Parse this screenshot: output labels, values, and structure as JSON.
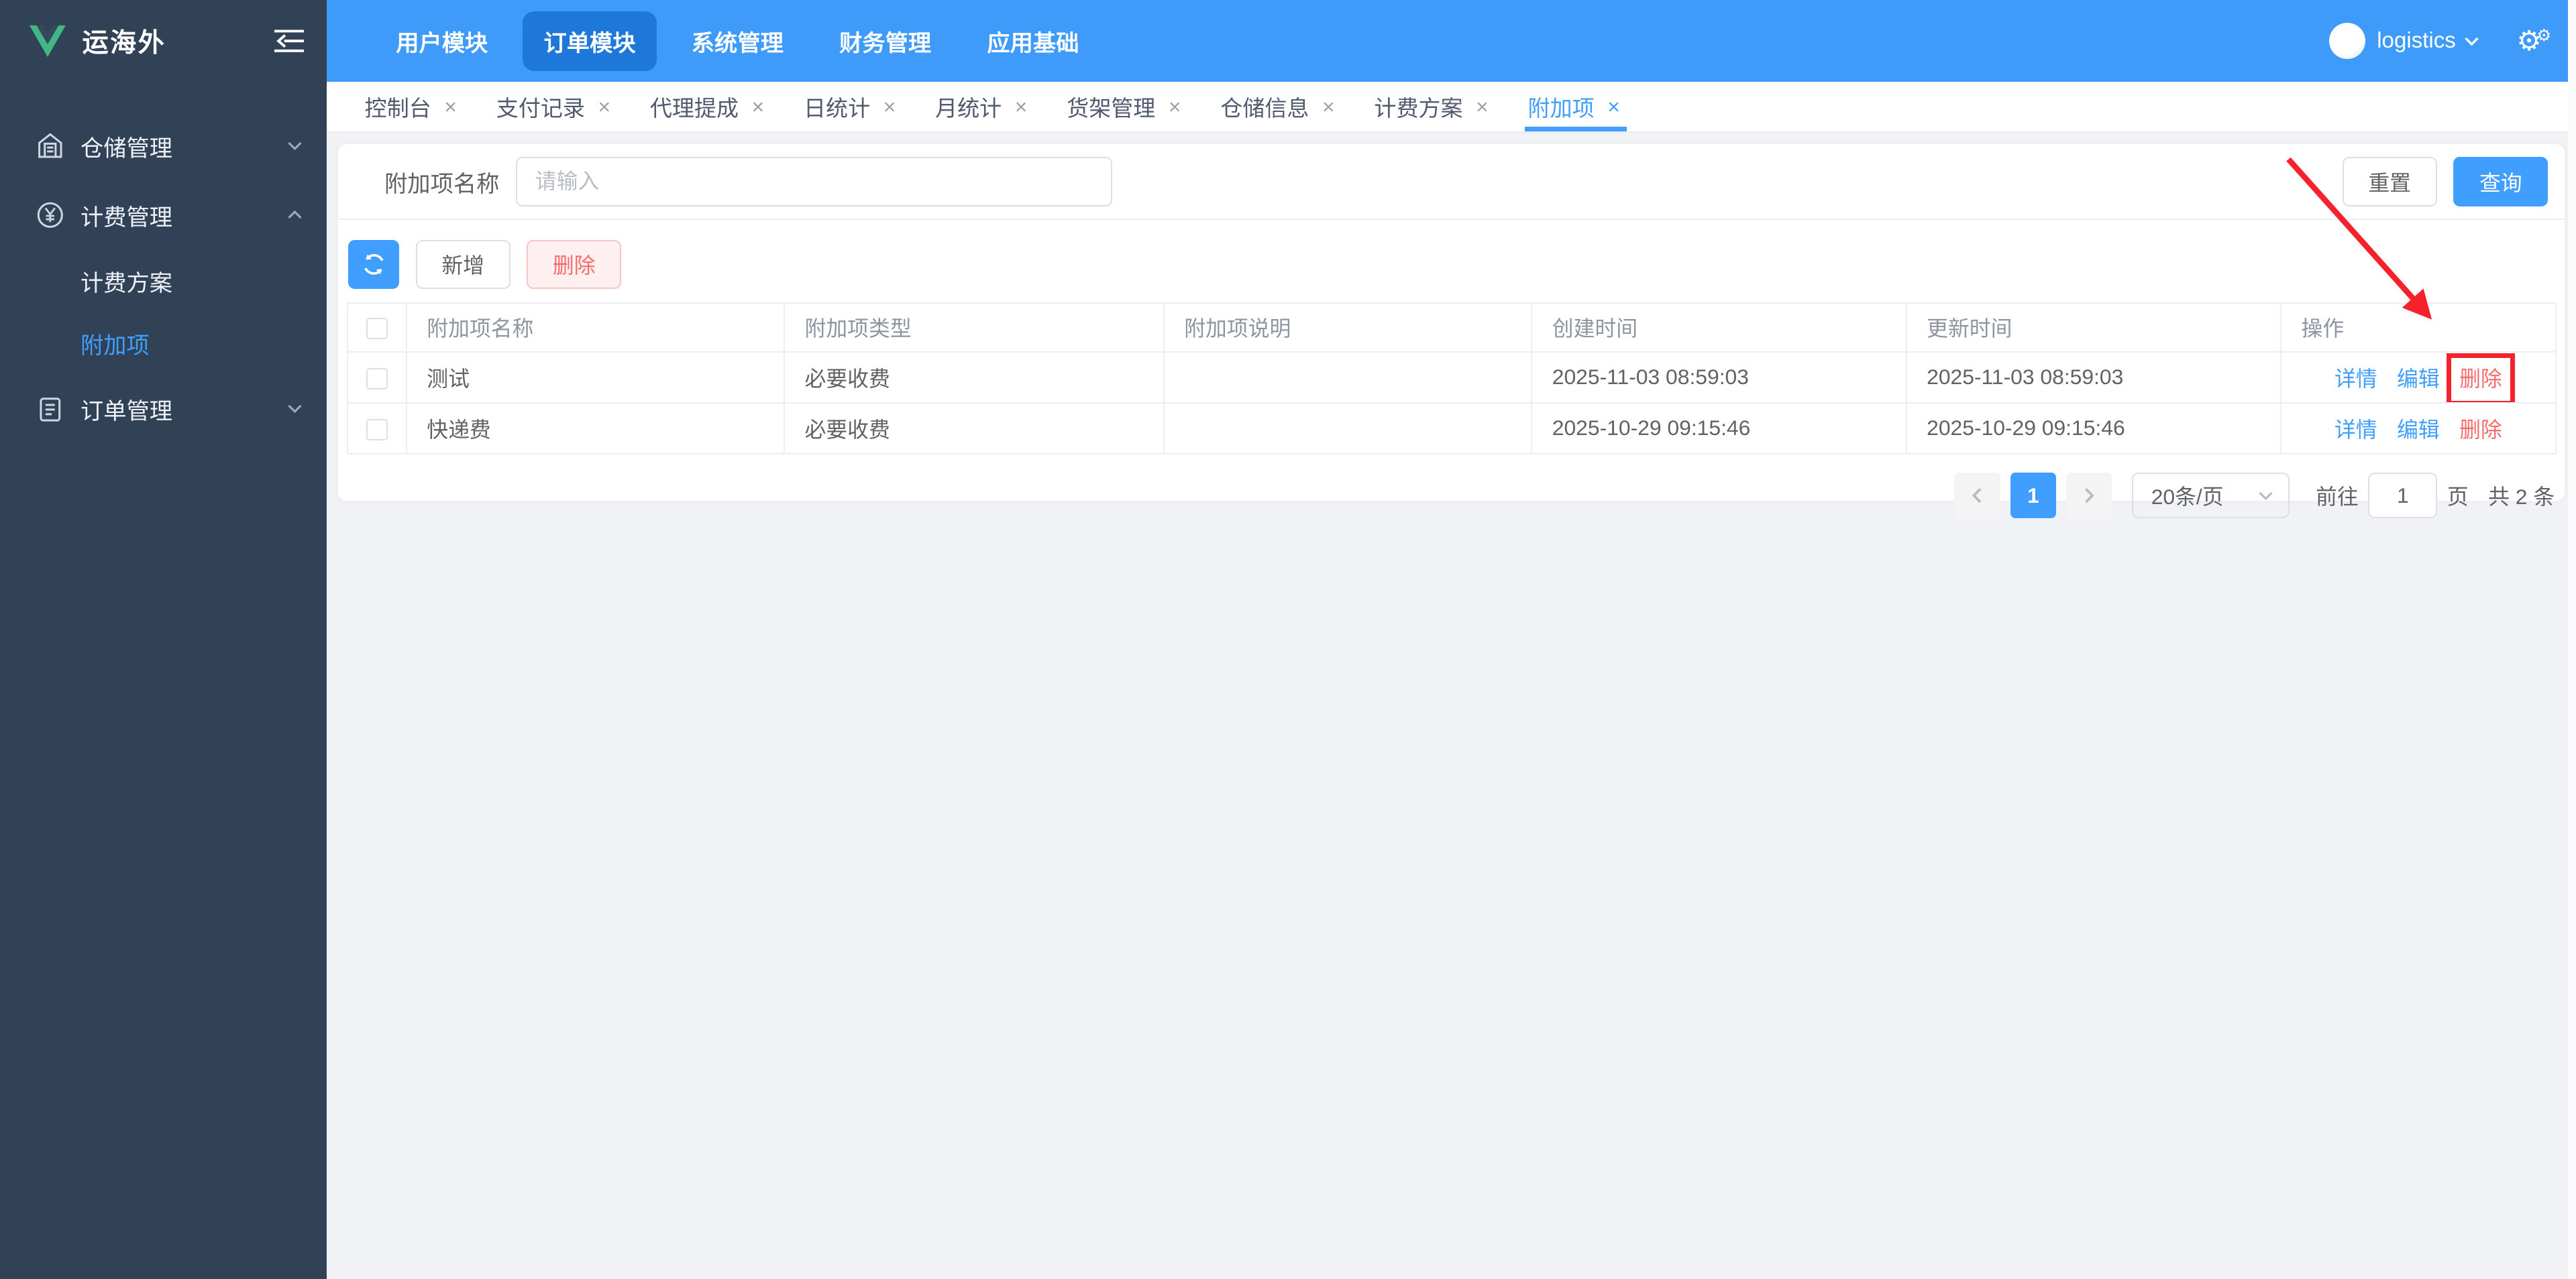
{
  "app": {
    "logo_text": "运海外"
  },
  "sidebar": {
    "items": [
      {
        "label": "仓储管理"
      },
      {
        "label": "计费管理"
      },
      {
        "label": "计费方案"
      },
      {
        "label": "附加项"
      },
      {
        "label": "订单管理"
      }
    ]
  },
  "topnav": {
    "items": [
      {
        "label": "用户模块"
      },
      {
        "label": "订单模块"
      },
      {
        "label": "系统管理"
      },
      {
        "label": "财务管理"
      },
      {
        "label": "应用基础"
      }
    ],
    "username": "logistics"
  },
  "tabs": {
    "close": "×",
    "items": [
      {
        "label": "控制台"
      },
      {
        "label": "支付记录"
      },
      {
        "label": "代理提成"
      },
      {
        "label": "日统计"
      },
      {
        "label": "月统计"
      },
      {
        "label": "货架管理"
      },
      {
        "label": "仓储信息"
      },
      {
        "label": "计费方案"
      },
      {
        "label": "附加项"
      }
    ]
  },
  "search": {
    "label": "附加项名称",
    "placeholder": "请输入",
    "reset_label": "重置",
    "query_label": "查询"
  },
  "toolbar": {
    "add_label": "新增",
    "delete_label": "删除"
  },
  "table": {
    "columns": [
      "附加项名称",
      "附加项类型",
      "附加项说明",
      "创建时间",
      "更新时间",
      "操作"
    ],
    "rows": [
      {
        "name": "测试",
        "type": "必要收费",
        "desc": "",
        "created": "2025-11-03 08:59:03",
        "updated": "2025-11-03 08:59:03",
        "action_detail": "详情",
        "action_edit": "编辑",
        "action_delete": "删除"
      },
      {
        "name": "快递费",
        "type": "必要收费",
        "desc": "",
        "created": "2025-10-29 09:15:46",
        "updated": "2025-10-29 09:15:46",
        "action_detail": "详情",
        "action_edit": "编辑",
        "action_delete": "删除"
      }
    ]
  },
  "pagination": {
    "page": "1",
    "size_option": "20条/页",
    "goto_label": "前往",
    "goto_value": "1",
    "page_unit": "页",
    "total_text": "共 2 条"
  },
  "colors": {
    "primary": "#409EFF",
    "topbar": "#3F9BFA",
    "sidebar_bg": "#314256",
    "danger": "#F56C6C",
    "annotation": "#F5222D"
  }
}
